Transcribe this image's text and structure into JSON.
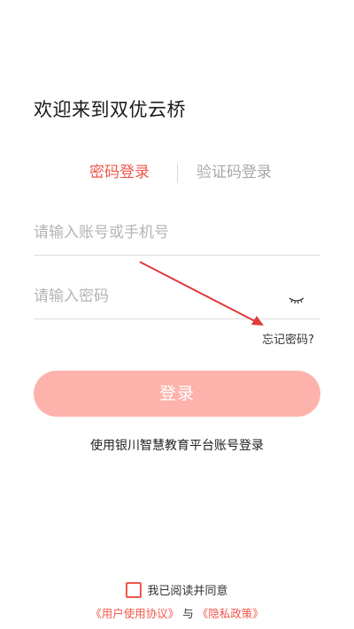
{
  "header": {
    "title": "欢迎来到双优云桥"
  },
  "tabs": {
    "password_login": "密码登录",
    "code_login": "验证码登录"
  },
  "form": {
    "account_placeholder": "请输入账号或手机号",
    "password_placeholder": "请输入密码",
    "forgot_password": "忘记密码?"
  },
  "login_button": "登录",
  "alt_login": "使用银川智慧教育平台账号登录",
  "agreement": {
    "checkbox_label": "我已阅读并同意",
    "user_agreement": "《用户使用协议》",
    "and": "与",
    "privacy_policy": "《隐私政策》"
  },
  "colors": {
    "accent": "#f0564b",
    "button_bg": "#fdb2ab",
    "inactive_tab": "#a8a8a8",
    "annotation_arrow": "#e03a3a"
  }
}
